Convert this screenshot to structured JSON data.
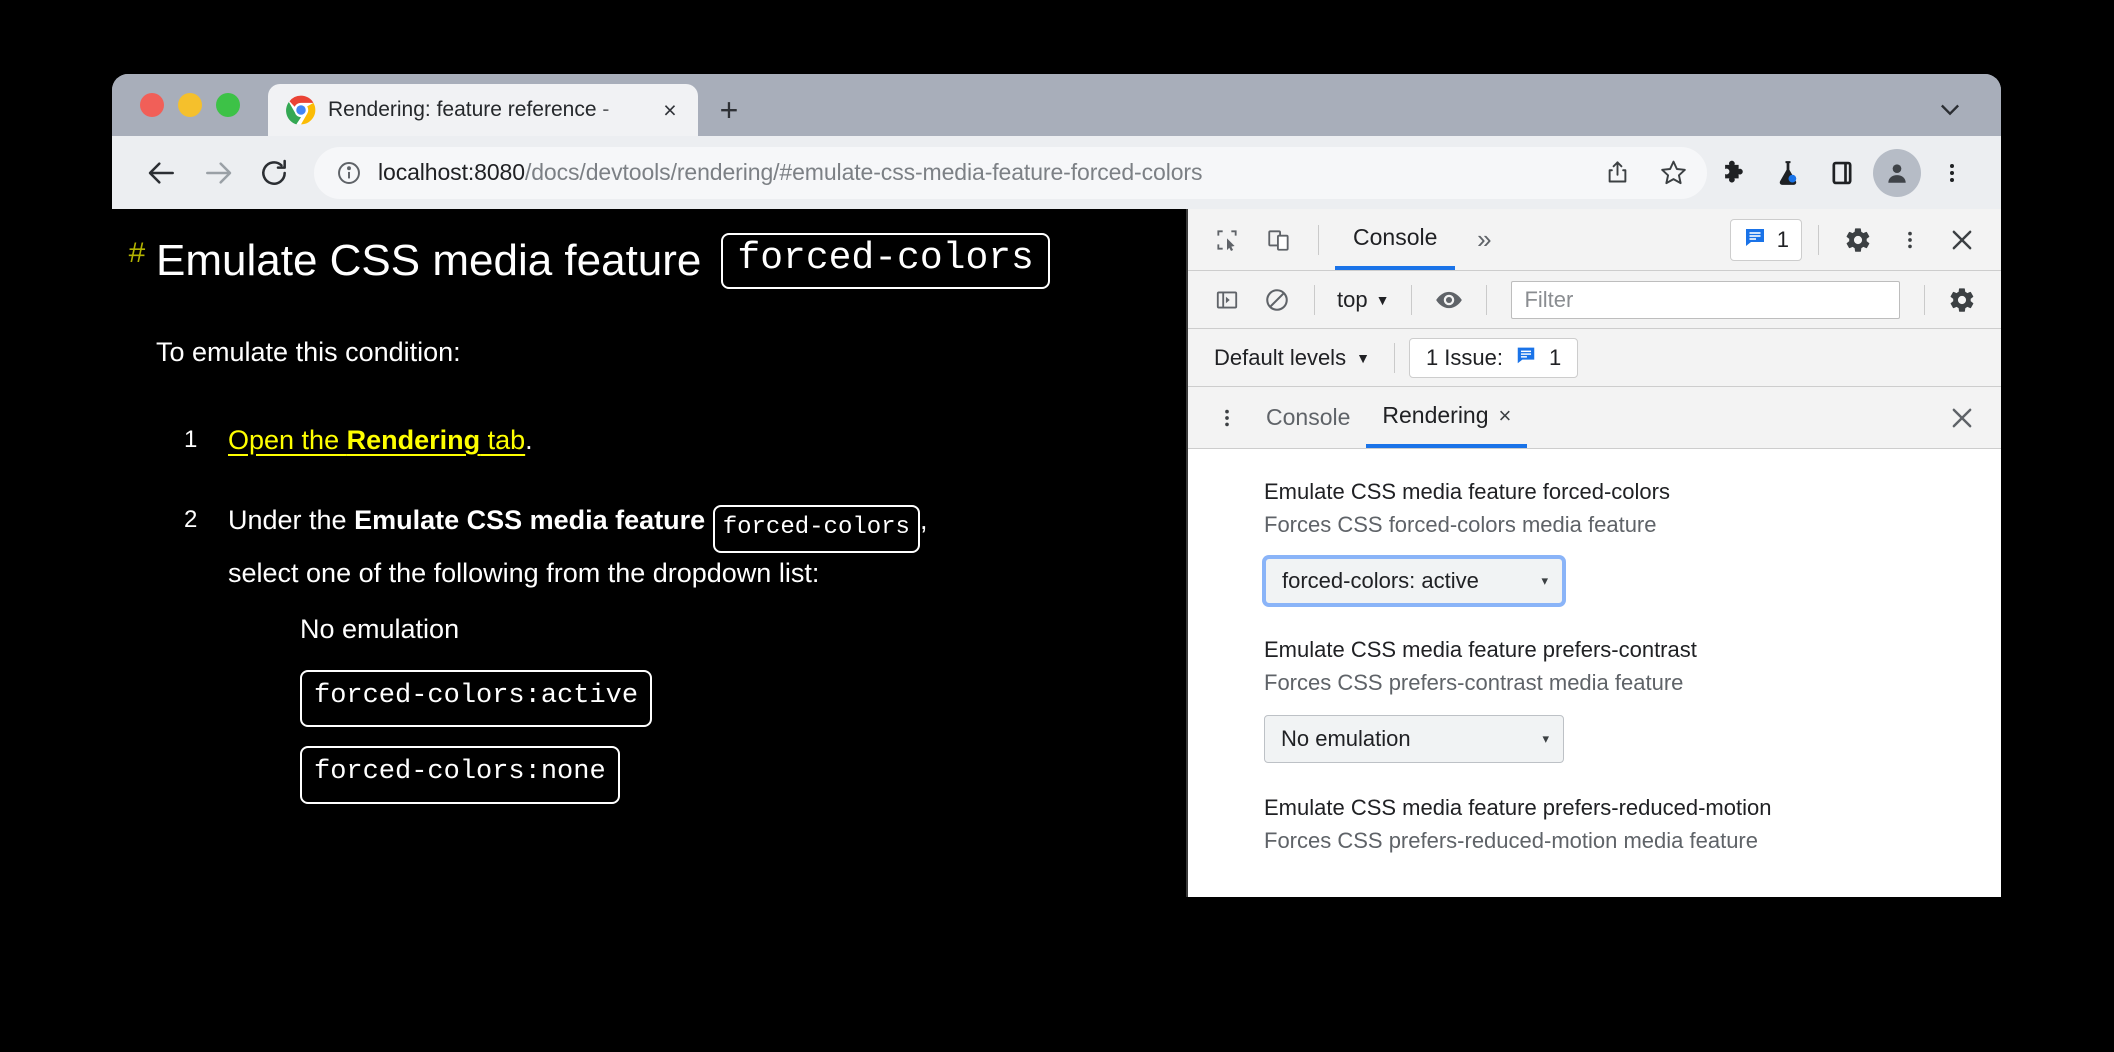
{
  "window": {
    "traffic_lights": [
      "close",
      "minimize",
      "maximize"
    ],
    "chevron_icon": "chevron-down-icon"
  },
  "tab": {
    "title": "Rendering: feature reference -",
    "favicon": "chrome-logo-icon",
    "close_label": "×",
    "new_tab_label": "+"
  },
  "omnibox": {
    "back_icon": "back-arrow-icon",
    "forward_icon": "forward-arrow-icon",
    "reload_icon": "reload-icon",
    "info_icon": "info-circle-icon",
    "url_host": "localhost:8080",
    "url_path": "/docs/devtools/rendering/#emulate-css-media-feature-forced-colors",
    "share_icon": "share-icon",
    "bookmark_icon": "star-icon",
    "extensions_icon": "puzzle-piece-icon",
    "experiment_icon": "flask-icon",
    "sidepanel_icon": "side-panel-icon",
    "profile_icon": "person-avatar-icon",
    "menu_icon": "three-dot-menu-icon"
  },
  "page": {
    "anchor": "#",
    "heading_text": "Emulate CSS media feature",
    "heading_code": "forced-colors",
    "intro": "To emulate this condition:",
    "steps": [
      {
        "num": "1",
        "link_prefix": "Open the ",
        "link_bold": "Rendering",
        "link_suffix": " tab",
        "tail": "."
      },
      {
        "num": "2",
        "prefix": "Under the ",
        "bold": "Emulate CSS media feature",
        "code": "forced-colors",
        "comma": ",",
        "line2": "select one of the following from the dropdown list:"
      }
    ],
    "options": [
      {
        "text": "No emulation",
        "code": false
      },
      {
        "text": "forced-colors:active",
        "code": true
      },
      {
        "text": "forced-colors:none",
        "code": true
      }
    ]
  },
  "devtools": {
    "inspect_icon": "inspect-element-icon",
    "device_icon": "device-toolbar-icon",
    "main_tab": "Console",
    "more_panels": "»",
    "issues_count": "1",
    "issues_icon": "issue-message-icon",
    "settings_icon": "gear-icon",
    "menu_icon": "three-dot-menu-icon",
    "close_icon": "close-icon",
    "filterbar": {
      "sidebar_icon": "console-sidebar-icon",
      "clear_icon": "clear-console-icon",
      "context": "top",
      "context_caret": "▼",
      "eye_icon": "live-expression-icon",
      "filter_placeholder": "Filter",
      "settings_icon": "gear-icon"
    },
    "levelbar": {
      "levels_label": "Default levels",
      "levels_caret": "▼",
      "issue_label": "1 Issue:",
      "issue_icon": "issue-message-icon",
      "issue_count": "1"
    },
    "drawer": {
      "menu_icon": "three-dot-menu-icon",
      "tabs": [
        {
          "label": "Console",
          "active": false,
          "closable": false
        },
        {
          "label": "Rendering",
          "active": true,
          "closable": true,
          "close": "×"
        }
      ],
      "close_icon": "close-icon"
    },
    "rendering": [
      {
        "title": "Emulate CSS media feature forced-colors",
        "desc": "Forces CSS forced-colors media feature",
        "value": "forced-colors: active",
        "caret": "▾",
        "focused": true
      },
      {
        "title": "Emulate CSS media feature prefers-contrast",
        "desc": "Forces CSS prefers-contrast media feature",
        "value": "No emulation",
        "caret": "▾",
        "focused": false
      },
      {
        "title": "Emulate CSS media feature prefers-reduced-motion",
        "desc": "Forces CSS prefers-reduced-motion media feature",
        "value": "",
        "caret": "",
        "focused": false
      }
    ]
  },
  "colors": {
    "accent_blue": "#1a73e8",
    "focus_blue": "#8ab4f8",
    "link_yellow": "#ffff00",
    "anchor_olive": "#b3b300",
    "page_bg": "#000000",
    "chrome_bg": "#a6adba"
  }
}
